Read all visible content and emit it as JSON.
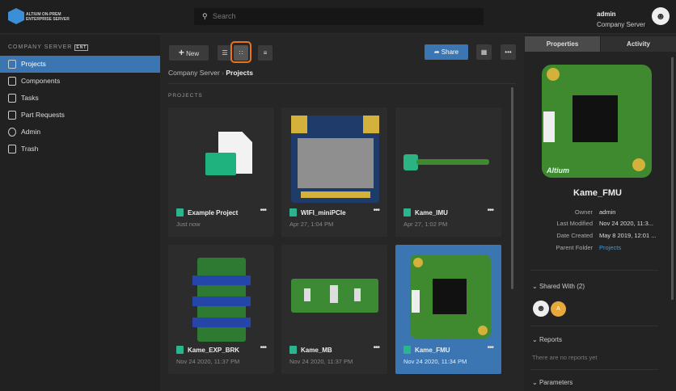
{
  "header": {
    "logo_text": "ALTIUM ON-PREM ENTERPRISE SERVER",
    "search_placeholder": "Search",
    "user_name": "admin",
    "user_server": "Company Server"
  },
  "sidebar": {
    "heading": "COMPANY SERVER",
    "badge": "ENT",
    "items": [
      {
        "label": "Projects",
        "icon": "folder-icon",
        "active": true
      },
      {
        "label": "Components",
        "icon": "component-icon"
      },
      {
        "label": "Tasks",
        "icon": "tasks-icon"
      },
      {
        "label": "Part Requests",
        "icon": "part-request-icon"
      },
      {
        "label": "Admin",
        "icon": "user-icon"
      },
      {
        "label": "Trash",
        "icon": "trash-icon"
      }
    ]
  },
  "toolbar": {
    "new_label": "New",
    "share_label": "Share",
    "more": "•••"
  },
  "breadcrumb": {
    "root": "Company Server",
    "sep": "›",
    "current": "Projects"
  },
  "section_label": "PROJECTS",
  "projects": [
    {
      "name": "Example Project",
      "date": "Just now"
    },
    {
      "name": "WIFI_miniPCIe",
      "date": "Apr 27, 1:04 PM"
    },
    {
      "name": "Kame_IMU",
      "date": "Apr 27, 1:02 PM"
    },
    {
      "name": "Kame_EXP_BRK",
      "date": "Nov 24 2020, 11:37 PM"
    },
    {
      "name": "Kame_MB",
      "date": "Nov 24 2020, 11:37 PM"
    },
    {
      "name": "Kame_FMU",
      "date": "Nov 24 2020, 11:34 PM",
      "selected": true
    }
  ],
  "panel": {
    "tabs": [
      "Properties",
      "Activity"
    ],
    "title": "Kame_FMU",
    "board_label": "Altium",
    "props": [
      {
        "k": "Owner",
        "v": "admin"
      },
      {
        "k": "Last Modified",
        "v": "Nov 24 2020, 11:3..."
      },
      {
        "k": "Date Created",
        "v": "May 8 2019, 12:01 ..."
      },
      {
        "k": "Parent Folder",
        "v": "Projects"
      }
    ],
    "shared_with": "Shared With",
    "shared_count": "(2)",
    "shared_avatar_letter": "A",
    "reports": "Reports",
    "reports_empty": "There are no reports yet",
    "parameters": "Parameters"
  },
  "colors": {
    "accent": "#3b76b3",
    "highlight": "#e8731f",
    "link": "#3d9be0"
  }
}
